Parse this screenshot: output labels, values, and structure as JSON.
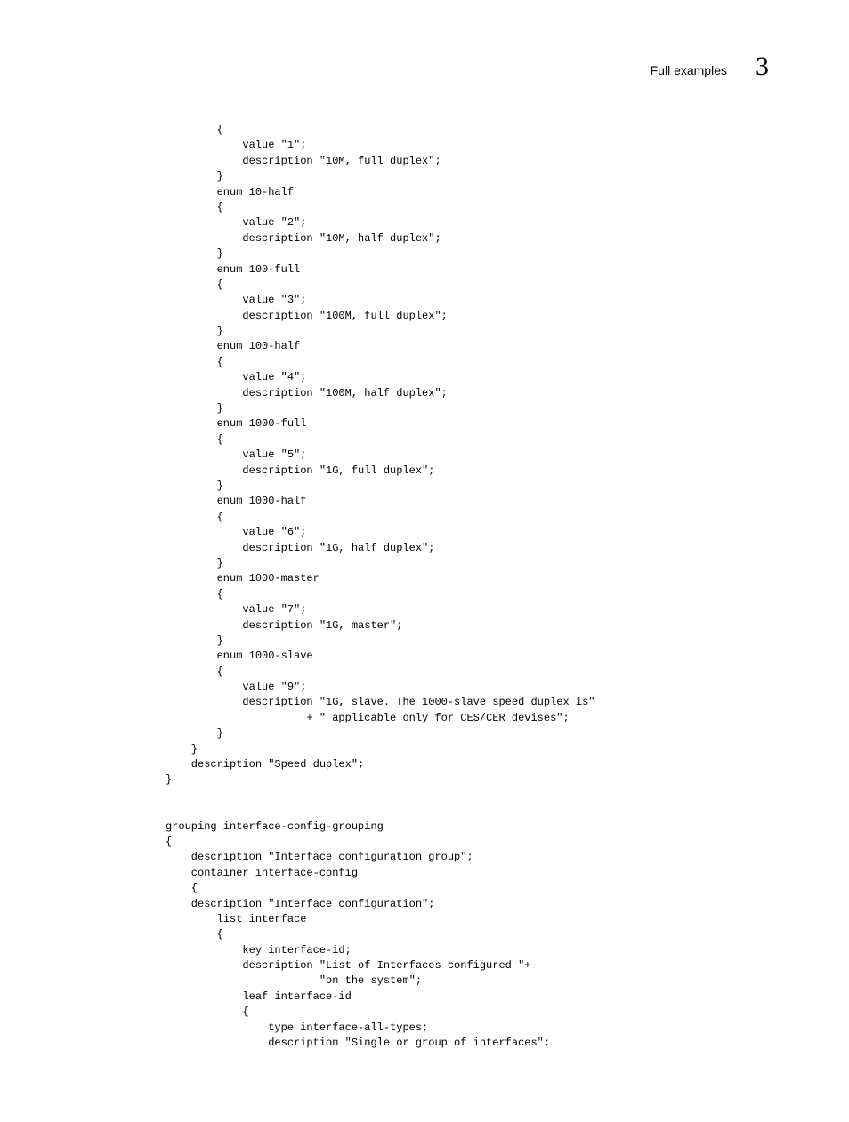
{
  "header": {
    "title": "Full examples",
    "section_number": "3"
  },
  "code": "        {\n            value \"1\";\n            description \"10M, full duplex\";\n        }\n        enum 10-half\n        {\n            value \"2\";\n            description \"10M, half duplex\";\n        }\n        enum 100-full\n        {\n            value \"3\";\n            description \"100M, full duplex\";\n        }\n        enum 100-half\n        {\n            value \"4\";\n            description \"100M, half duplex\";\n        }\n        enum 1000-full\n        {\n            value \"5\";\n            description \"1G, full duplex\";\n        }\n        enum 1000-half\n        {\n            value \"6\";\n            description \"1G, half duplex\";\n        }\n        enum 1000-master\n        {\n            value \"7\";\n            description \"1G, master\";\n        }\n        enum 1000-slave\n        {\n            value \"9\";\n            description \"1G, slave. The 1000-slave speed duplex is\"\n                      + \" applicable only for CES/CER devises\";\n        }\n    }\n    description \"Speed duplex\";\n}\n\n\ngrouping interface-config-grouping\n{\n    description \"Interface configuration group\";\n    container interface-config\n    {\n    description \"Interface configuration\";\n        list interface\n        {\n            key interface-id;\n            description \"List of Interfaces configured \"+\n                        \"on the system\";\n            leaf interface-id\n            {\n                type interface-all-types;\n                description \"Single or group of interfaces\";"
}
